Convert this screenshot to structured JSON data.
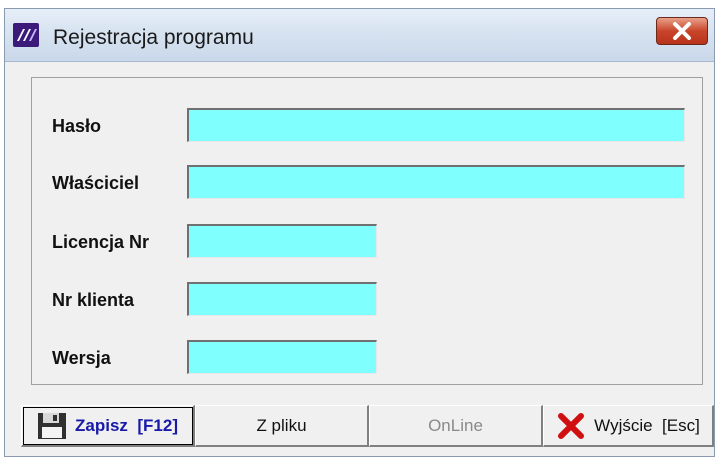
{
  "window": {
    "title": "Rejestracja programu"
  },
  "fields": [
    {
      "label": "Hasło",
      "value": ""
    },
    {
      "label": "Właściciel",
      "value": ""
    },
    {
      "label": "Licencja Nr",
      "value": ""
    },
    {
      "label": "Nr klienta",
      "value": ""
    },
    {
      "label": "Wersja",
      "value": ""
    }
  ],
  "buttons": {
    "save": "Zapisz  [F12]",
    "from_file": "Z pliku",
    "online": "OnLine",
    "exit": "Wyjście  [Esc]"
  },
  "icons": {
    "app": "app-logo-icon",
    "close": "close-icon",
    "save": "floppy-disk-icon",
    "exit": "red-x-icon"
  },
  "colors": {
    "input_bg": "#80ffff",
    "save_label": "#1a1aa8",
    "close_button": "#c9452a",
    "exit_icon": "#d01010"
  }
}
